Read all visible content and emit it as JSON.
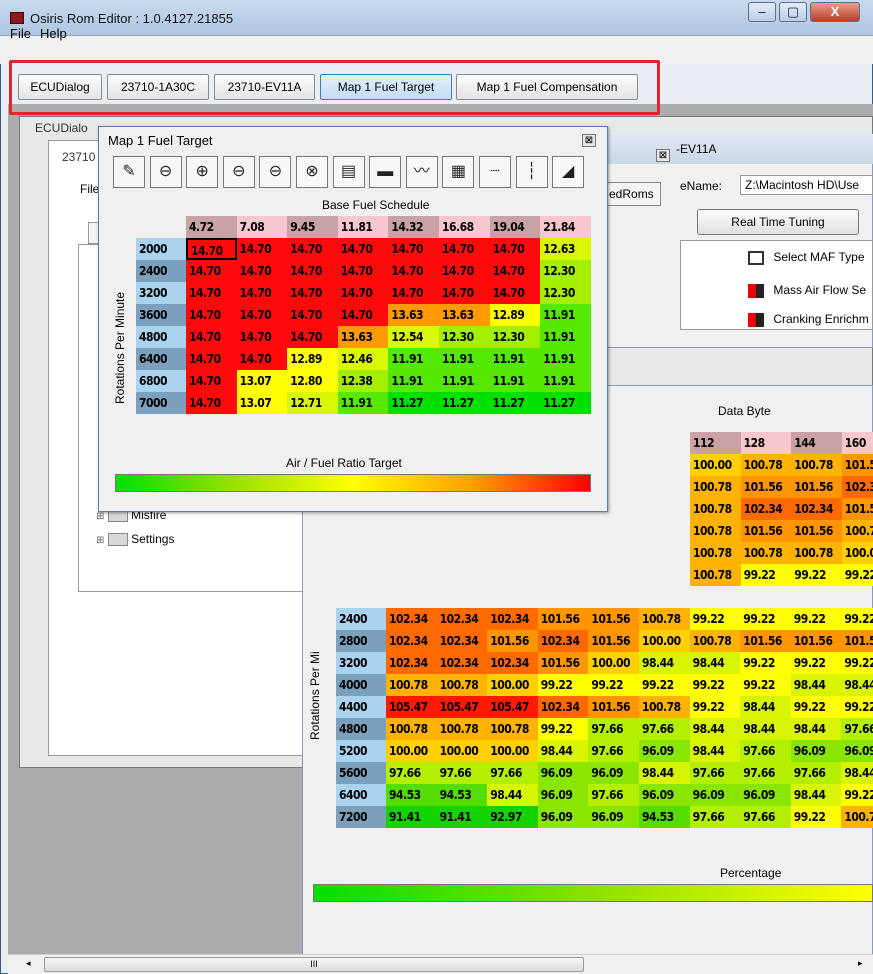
{
  "window": {
    "title": "Osiris Rom Editor : 1.0.4127.21855",
    "controls": [
      "–",
      "▢",
      "X"
    ]
  },
  "menu": [
    "File",
    "Help"
  ],
  "tabs": [
    "ECUDialog",
    "23710-1A30C",
    "23710-EV11A",
    "Map 1 Fuel Target",
    "Map 1 Fuel Compensation"
  ],
  "background": {
    "ecu_dialog_title": "ECUDialo",
    "win_23710_title": "23710",
    "file_label": "File",
    "edroms_label": "edRoms",
    "tree_folders": [
      "Misfire",
      "Settings"
    ]
  },
  "ev11a": {
    "title": "-EV11A",
    "close": "⊠",
    "filename_label": "eName:",
    "filename_value": "Z:\\Macintosh HD\\Use",
    "realtime_button": "Real Time Tuning",
    "tree_items": [
      "Select MAF Type",
      "Mass Air Flow Se",
      "Cranking Enrichm"
    ]
  },
  "fuel_target": {
    "title": "Map 1 Fuel Target",
    "close": "⊠",
    "table_title": "Base Fuel Schedule",
    "ylabel": "Rotations Per Minute",
    "footer": "Air / Fuel Ratio Target",
    "toolbar_icons": [
      "edit-icon",
      "remove-column-icon",
      "add-row-icon",
      "remove-row-icon",
      "remove-cell-icon",
      "delete-icon",
      "export-icon",
      "monitor-icon",
      "line-graph-icon",
      "grid-icon",
      "horizontal-line-icon",
      "vertical-line-icon",
      "surface-graph-icon"
    ],
    "toolbar_glyphs": [
      "✎",
      "⊖",
      "⊕",
      "⊖",
      "⊖",
      "⊗",
      "▤",
      "▬",
      "〰",
      "▦",
      "┈",
      "┆",
      "◢"
    ],
    "columns": [
      "4.72",
      "7.08",
      "9.45",
      "11.81",
      "14.32",
      "16.68",
      "19.04",
      "21.84"
    ],
    "rows": [
      "2000",
      "2400",
      "3200",
      "3600",
      "4800",
      "6400",
      "6800",
      "7000"
    ],
    "values": [
      [
        "14.70",
        "14.70",
        "14.70",
        "14.70",
        "14.70",
        "14.70",
        "14.70",
        "12.63"
      ],
      [
        "14.70",
        "14.70",
        "14.70",
        "14.70",
        "14.70",
        "14.70",
        "14.70",
        "12.30"
      ],
      [
        "14.70",
        "14.70",
        "14.70",
        "14.70",
        "14.70",
        "14.70",
        "14.70",
        "12.30"
      ],
      [
        "14.70",
        "14.70",
        "14.70",
        "14.70",
        "13.63",
        "13.63",
        "12.89",
        "11.91"
      ],
      [
        "14.70",
        "14.70",
        "14.70",
        "13.63",
        "12.54",
        "12.30",
        "12.30",
        "11.91"
      ],
      [
        "14.70",
        "14.70",
        "12.89",
        "12.46",
        "11.91",
        "11.91",
        "11.91",
        "11.91"
      ],
      [
        "14.70",
        "13.07",
        "12.80",
        "12.38",
        "11.91",
        "11.91",
        "11.91",
        "11.91"
      ],
      [
        "14.70",
        "13.07",
        "12.71",
        "11.91",
        "11.27",
        "11.27",
        "11.27",
        "11.27"
      ]
    ],
    "selected": "14.70"
  },
  "compensation": {
    "xlabel": "Data Byte",
    "ylabel": "Rotations Per Mi",
    "footer": "Percentage",
    "columns_visible": [
      "112",
      "128",
      "144",
      "160"
    ],
    "upper_rows": [
      [
        "100.00",
        "100.78",
        "100.78",
        "101.5"
      ],
      [
        "100.78",
        "101.56",
        "101.56",
        "102.3"
      ],
      [
        "100.78",
        "102.34",
        "102.34",
        "101.5"
      ],
      [
        "100.78",
        "101.56",
        "101.56",
        "100.7"
      ],
      [
        "100.78",
        "100.78",
        "100.78",
        "100.0"
      ],
      [
        "100.78",
        "99.22",
        "99.22",
        "99.22"
      ]
    ],
    "rows": [
      "2400",
      "2800",
      "3200",
      "4000",
      "4400",
      "4800",
      "5200",
      "5600",
      "6400",
      "7200"
    ],
    "values": [
      [
        "102.34",
        "102.34",
        "102.34",
        "101.56",
        "101.56",
        "100.78",
        "99.22",
        "99.22",
        "99.22",
        "99.22"
      ],
      [
        "102.34",
        "102.34",
        "101.56",
        "102.34",
        "101.56",
        "100.00",
        "100.78",
        "101.56",
        "101.56",
        "101.5"
      ],
      [
        "102.34",
        "102.34",
        "102.34",
        "101.56",
        "100.00",
        "98.44",
        "98.44",
        "99.22",
        "99.22",
        "99.22"
      ],
      [
        "100.78",
        "100.78",
        "100.00",
        "99.22",
        "99.22",
        "99.22",
        "99.22",
        "99.22",
        "98.44",
        "98.44"
      ],
      [
        "105.47",
        "105.47",
        "105.47",
        "102.34",
        "101.56",
        "100.78",
        "99.22",
        "98.44",
        "99.22",
        "99.22"
      ],
      [
        "100.78",
        "100.78",
        "100.78",
        "99.22",
        "97.66",
        "97.66",
        "98.44",
        "98.44",
        "98.44",
        "97.66"
      ],
      [
        "100.00",
        "100.00",
        "100.00",
        "98.44",
        "97.66",
        "96.09",
        "98.44",
        "97.66",
        "96.09",
        "96.09"
      ],
      [
        "97.66",
        "97.66",
        "97.66",
        "96.09",
        "96.09",
        "98.44",
        "97.66",
        "97.66",
        "97.66",
        "98.44"
      ],
      [
        "94.53",
        "94.53",
        "98.44",
        "96.09",
        "97.66",
        "96.09",
        "96.09",
        "96.09",
        "98.44",
        "99.22"
      ],
      [
        "91.41",
        "91.41",
        "92.97",
        "96.09",
        "96.09",
        "94.53",
        "97.66",
        "97.66",
        "99.22",
        "100.7"
      ]
    ]
  },
  "scrollbar": {
    "thumb": "III",
    "left": "◂",
    "right": "▸"
  }
}
